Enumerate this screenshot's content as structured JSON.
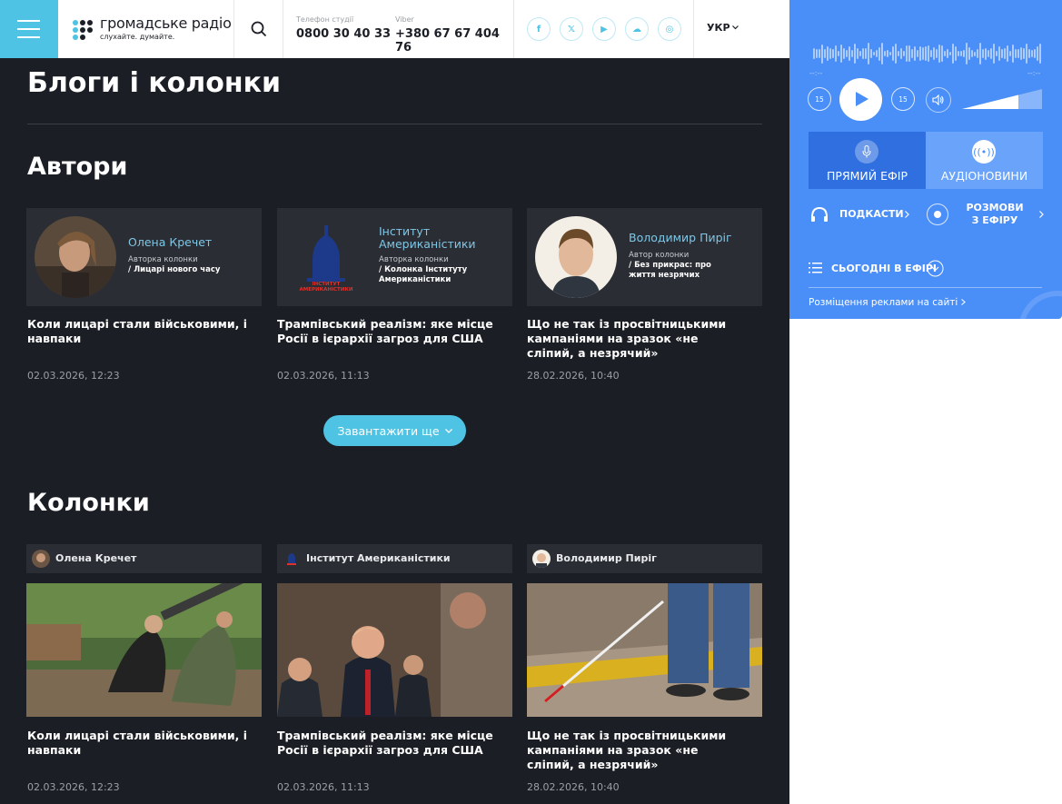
{
  "header": {
    "logo_title": "громадське радіо",
    "logo_subtitle": "слухайте. думайте.",
    "phone_label": "Телефон студії",
    "phone_value": "0800 30 40 33",
    "viber_label": "Viber",
    "viber_value": "+380 67 67 404 76",
    "socials": [
      "f",
      "𝕏",
      "▶",
      "☁",
      "◎"
    ],
    "lang": "УКР"
  },
  "page": {
    "title": "Блоги і колонки",
    "authors_heading": "Автори",
    "columns_heading": "Колонки",
    "load_more": "Завантажити ще"
  },
  "authors": [
    {
      "name": "Олена Кречет",
      "role": "Авторка колонки",
      "column": "/ Лицарі нового часу",
      "post_title": "Коли лицарі стали військовими, і навпаки",
      "date": "02.03.2026, 12:23"
    },
    {
      "name": "Інститут Американістики",
      "role": "Авторка колонки",
      "column": "/ Колонка Інституту Американістики",
      "post_title": "Трампівський реалізм: яке місце Росії в ієрархії загроз для США",
      "date": "02.03.2026, 11:13",
      "logo_text": "ІНСТИТУТ АМЕРИКАНІСТИКИ"
    },
    {
      "name": "Володимир Пиріг",
      "role": "Автор колонки",
      "column": "/ Без прикрас: про життя незрячих",
      "post_title": "Що не так із просвітницькими кампаніями на зразок «не сліпий, а незрячий»",
      "date": "28.02.2026, 10:40"
    }
  ],
  "columns": [
    {
      "author": "Олена Кречет",
      "title": "Коли лицарі стали військовими, і навпаки",
      "date": "02.03.2026, 12:23"
    },
    {
      "author": "Інститут Американістики",
      "title": "Трампівський реалізм: яке місце Росії в ієрархії загроз для США",
      "date": "02.03.2026, 11:13"
    },
    {
      "author": "Володимир Пиріг",
      "title": "Що не так із просвітницькими кампаніями на зразок «не сліпий, а незрячий»",
      "date": "28.02.2026, 10:40"
    }
  ],
  "player": {
    "time_left": "--:--",
    "time_right": "--:--",
    "rewind": "15",
    "forward": "15",
    "live_label": "ПРЯМИЙ ЕФІР",
    "news_label": "АУДІОНОВИНИ",
    "podcasts": "ПОДКАСТИ",
    "talks": "РОЗМОВИ З ЕФІРУ",
    "today": "СЬОГОДНІ В ЕФІРІ",
    "ads": "Розміщення реклами на сайті"
  },
  "colors": {
    "accent": "#4fc3e3",
    "dark_bg": "#1b1e24",
    "card_bg": "#2a2d33",
    "player_blue": "#4a8ef7"
  }
}
